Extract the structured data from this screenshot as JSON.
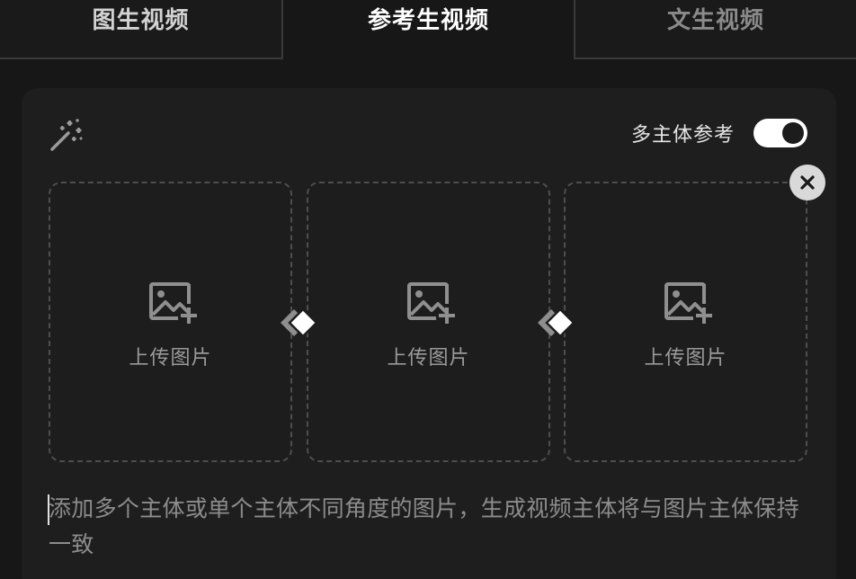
{
  "tabs": [
    {
      "label": "图生视频",
      "state": "inactive"
    },
    {
      "label": "参考生视频",
      "state": "active"
    },
    {
      "label": "文生视频",
      "state": "disabled"
    }
  ],
  "card": {
    "magic_icon": "magic-wand-icon",
    "toggle_label": "多主体参考",
    "toggle_on": true,
    "close_icon": "close-icon",
    "uploads": [
      {
        "label": "上传图片",
        "icon": "image-add-icon"
      },
      {
        "label": "上传图片",
        "icon": "image-add-icon"
      },
      {
        "label": "上传图片",
        "icon": "image-add-icon"
      }
    ],
    "link_icon": "diamond-link-icon",
    "prompt_placeholder": "添加多个主体或单个主体不同角度的图片，生成视频主体将与图片主体保持一致"
  },
  "colors": {
    "background": "#171717",
    "card": "#1e1e1e",
    "active_tab_text": "#ffffff",
    "inactive_tab_text": "#d2d2d2",
    "disabled_tab_text": "#8a8a8a",
    "toggle_on": "#ffffff"
  }
}
